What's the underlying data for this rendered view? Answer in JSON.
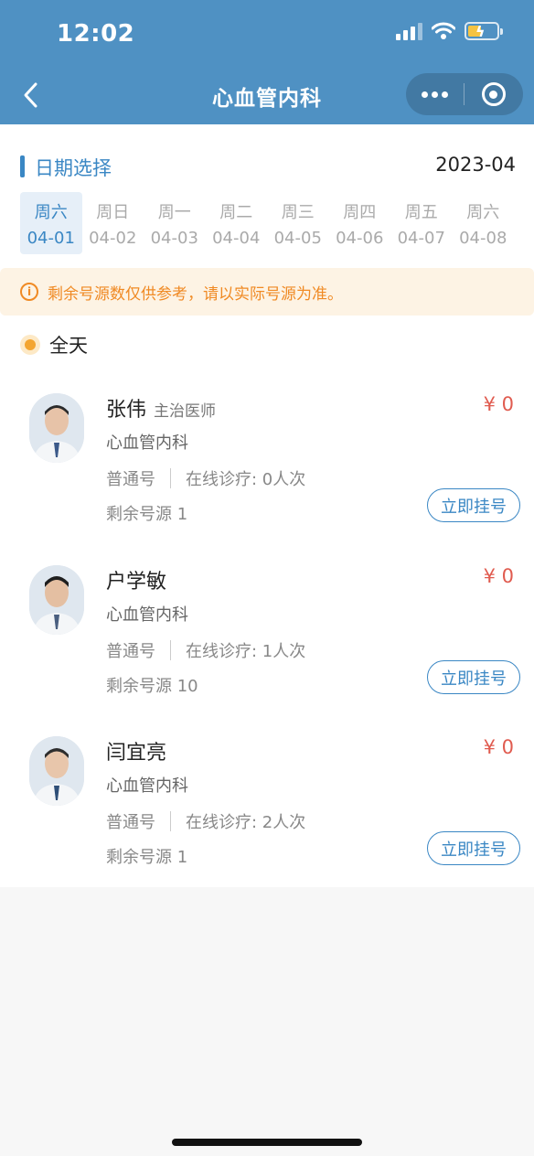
{
  "status_bar": {
    "time": "12:02"
  },
  "nav": {
    "title": "心血管内科"
  },
  "date_section": {
    "label": "日期选择",
    "month": "2023-04"
  },
  "days": [
    {
      "weekday": "周六",
      "date": "04-01",
      "active": true
    },
    {
      "weekday": "周日",
      "date": "04-02"
    },
    {
      "weekday": "周一",
      "date": "04-03"
    },
    {
      "weekday": "周二",
      "date": "04-04"
    },
    {
      "weekday": "周三",
      "date": "04-05"
    },
    {
      "weekday": "周四",
      "date": "04-06"
    },
    {
      "weekday": "周五",
      "date": "04-07"
    },
    {
      "weekday": "周六",
      "date": "04-08"
    }
  ],
  "notice": {
    "icon": "info-icon",
    "text": "剩余号源数仅供参考，请以实际号源为准。"
  },
  "period": {
    "label": "全天"
  },
  "doctors": [
    {
      "name": "张伟",
      "title": "主治医师",
      "dept": "心血管内科",
      "type": "普通号",
      "online": "在线诊疗: 0人次",
      "remain": "剩余号源 1",
      "price": "¥ 0",
      "button": "立即挂号"
    },
    {
      "name": "户学敏",
      "title": "",
      "dept": "心血管内科",
      "type": "普通号",
      "online": "在线诊疗: 1人次",
      "remain": "剩余号源 10",
      "price": "¥ 0",
      "button": "立即挂号"
    },
    {
      "name": "闫宜亮",
      "title": "",
      "dept": "心血管内科",
      "type": "普通号",
      "online": "在线诊疗: 2人次",
      "remain": "剩余号源 1",
      "price": "¥ 0",
      "button": "立即挂号"
    }
  ],
  "colors": {
    "header": "#4f91c3",
    "accent": "#3a87c4",
    "price": "#e05b4f",
    "notice": "#f08a24"
  }
}
